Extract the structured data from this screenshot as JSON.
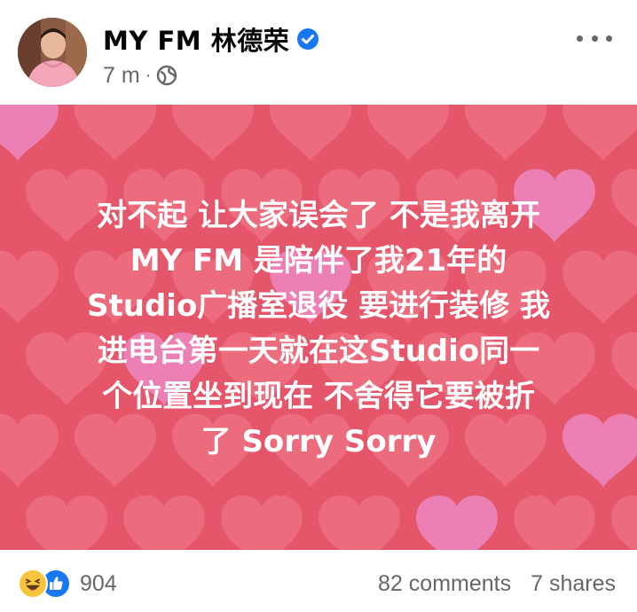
{
  "post": {
    "author": "MY FM 林德荣",
    "time": "7 m",
    "separator": "·",
    "text_lines": [
      "对不起 让大家误会了 不是我离开",
      "MY FM 是陪伴了我21年的",
      "Studio广播室退役 要进行装修 我",
      "进电台第一天就在这Studio同一",
      "个位置坐到现在 不舍得它要被折",
      "了 Sorry Sorry"
    ],
    "background_color": "#e6566a"
  },
  "engagement": {
    "reactions": "904",
    "comments": "82 comments",
    "shares": "7 shares"
  },
  "icons": {
    "verified": "verified-badge-icon",
    "audience": "globe-icon",
    "more": "more-options-icon",
    "reaction1": "haha-reaction-icon",
    "reaction2": "like-reaction-icon"
  },
  "colors": {
    "brand_blue": "#1877f2",
    "meta_gray": "#65676b"
  }
}
